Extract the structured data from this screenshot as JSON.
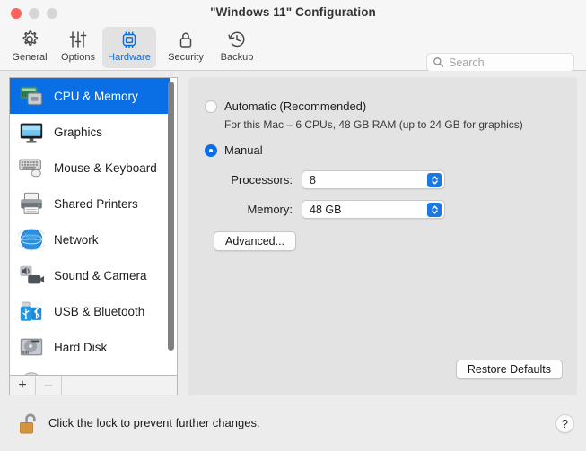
{
  "window": {
    "title": "\"Windows 11\" Configuration",
    "traffic_lights": {
      "close": "close-button",
      "minimize": "minimize-button",
      "maximize": "maximize-button"
    }
  },
  "toolbar": {
    "items": [
      {
        "id": "general",
        "label": "General",
        "icon": "gear-icon",
        "selected": false
      },
      {
        "id": "options",
        "label": "Options",
        "icon": "sliders-icon",
        "selected": false
      },
      {
        "id": "hardware",
        "label": "Hardware",
        "icon": "chip-icon",
        "selected": true
      },
      {
        "id": "security",
        "label": "Security",
        "icon": "lock-icon",
        "selected": false
      },
      {
        "id": "backup",
        "label": "Backup",
        "icon": "clock-back-icon",
        "selected": false
      }
    ],
    "search": {
      "placeholder": "Search",
      "value": "",
      "icon": "search-icon"
    }
  },
  "sidebar": {
    "items": [
      {
        "label": "CPU & Memory",
        "icon": "cpu-memory-icon",
        "selected": true
      },
      {
        "label": "Graphics",
        "icon": "display-icon",
        "selected": false
      },
      {
        "label": "Mouse & Keyboard",
        "icon": "keyboard-mouse-icon",
        "selected": false
      },
      {
        "label": "Shared Printers",
        "icon": "printer-icon",
        "selected": false
      },
      {
        "label": "Network",
        "icon": "globe-icon",
        "selected": false
      },
      {
        "label": "Sound & Camera",
        "icon": "sound-camera-icon",
        "selected": false
      },
      {
        "label": "USB & Bluetooth",
        "icon": "usb-bluetooth-icon",
        "selected": false
      },
      {
        "label": "Hard Disk",
        "icon": "hard-disk-icon",
        "selected": false
      }
    ],
    "footer": {
      "add_label": "+",
      "remove_label": "–"
    }
  },
  "main": {
    "automatic": {
      "label": "Automatic (Recommended)",
      "selected": false,
      "description": "For this Mac – 6 CPUs, 48 GB RAM (up to 24 GB for graphics)"
    },
    "manual": {
      "label": "Manual",
      "selected": true
    },
    "processors": {
      "label": "Processors:",
      "value": "8"
    },
    "memory": {
      "label": "Memory:",
      "value": "48 GB"
    },
    "advanced_label": "Advanced...",
    "restore_defaults_label": "Restore Defaults"
  },
  "bottom": {
    "lock_icon": "open-padlock-icon",
    "lock_text": "Click the lock to prevent further changes.",
    "help_label": "?"
  },
  "colors": {
    "accent": "#0a6fe4",
    "window_bg": "#ececec",
    "content_bg": "#e3e3e3",
    "toolbar_bg": "#f6f6f6",
    "close_red": "#ff6159"
  }
}
